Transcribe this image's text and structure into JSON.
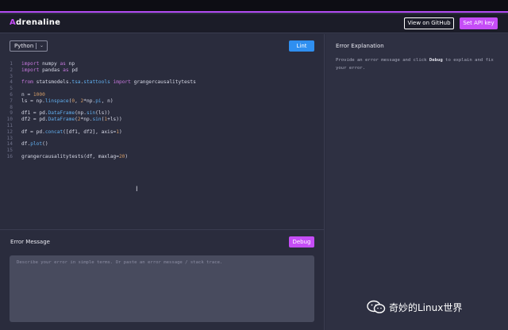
{
  "header": {
    "logo_prefix": "A",
    "logo_rest": "drenaline",
    "github_label": "View on GitHub",
    "api_key_label": "Set API key"
  },
  "editor": {
    "language": "Python",
    "lint_label": "Lint",
    "lines": [
      {
        "n": "1",
        "text": "import numpy as np"
      },
      {
        "n": "2",
        "text": "import pandas as pd"
      },
      {
        "n": "3",
        "text": ""
      },
      {
        "n": "4",
        "text": "from statsmodels.tsa.stattools import grangercausalitytests"
      },
      {
        "n": "5",
        "text": ""
      },
      {
        "n": "6",
        "text": "n = 1000"
      },
      {
        "n": "7",
        "text": "ls = np.linspace(0, 2*np.pi, n)"
      },
      {
        "n": "8",
        "text": ""
      },
      {
        "n": "9",
        "text": "df1 = pd.DataFrame(np.sin(ls))"
      },
      {
        "n": "10",
        "text": "df2 = pd.DataFrame(2*np.sin(1+ls))"
      },
      {
        "n": "11",
        "text": ""
      },
      {
        "n": "12",
        "text": "df = pd.concat([df1, df2], axis=1)"
      },
      {
        "n": "13",
        "text": ""
      },
      {
        "n": "14",
        "text": "df.plot()"
      },
      {
        "n": "15",
        "text": ""
      },
      {
        "n": "16",
        "text": "grangercausalitytests(df, maxlag=20)"
      }
    ]
  },
  "error_message": {
    "title": "Error Message",
    "debug_label": "Debug",
    "value": "",
    "placeholder": "Describe your error in simple terms. Or paste an error message / stack trace."
  },
  "explanation": {
    "title": "Error Explanation",
    "text_before": "Provide an error message and click ",
    "text_bold": "Debug",
    "text_after": " to explain and fix your error."
  },
  "watermark": {
    "text": "奇妙的Linux世界"
  },
  "colors": {
    "accent": "#c54df6",
    "lint_blue": "#2f8ff0"
  }
}
